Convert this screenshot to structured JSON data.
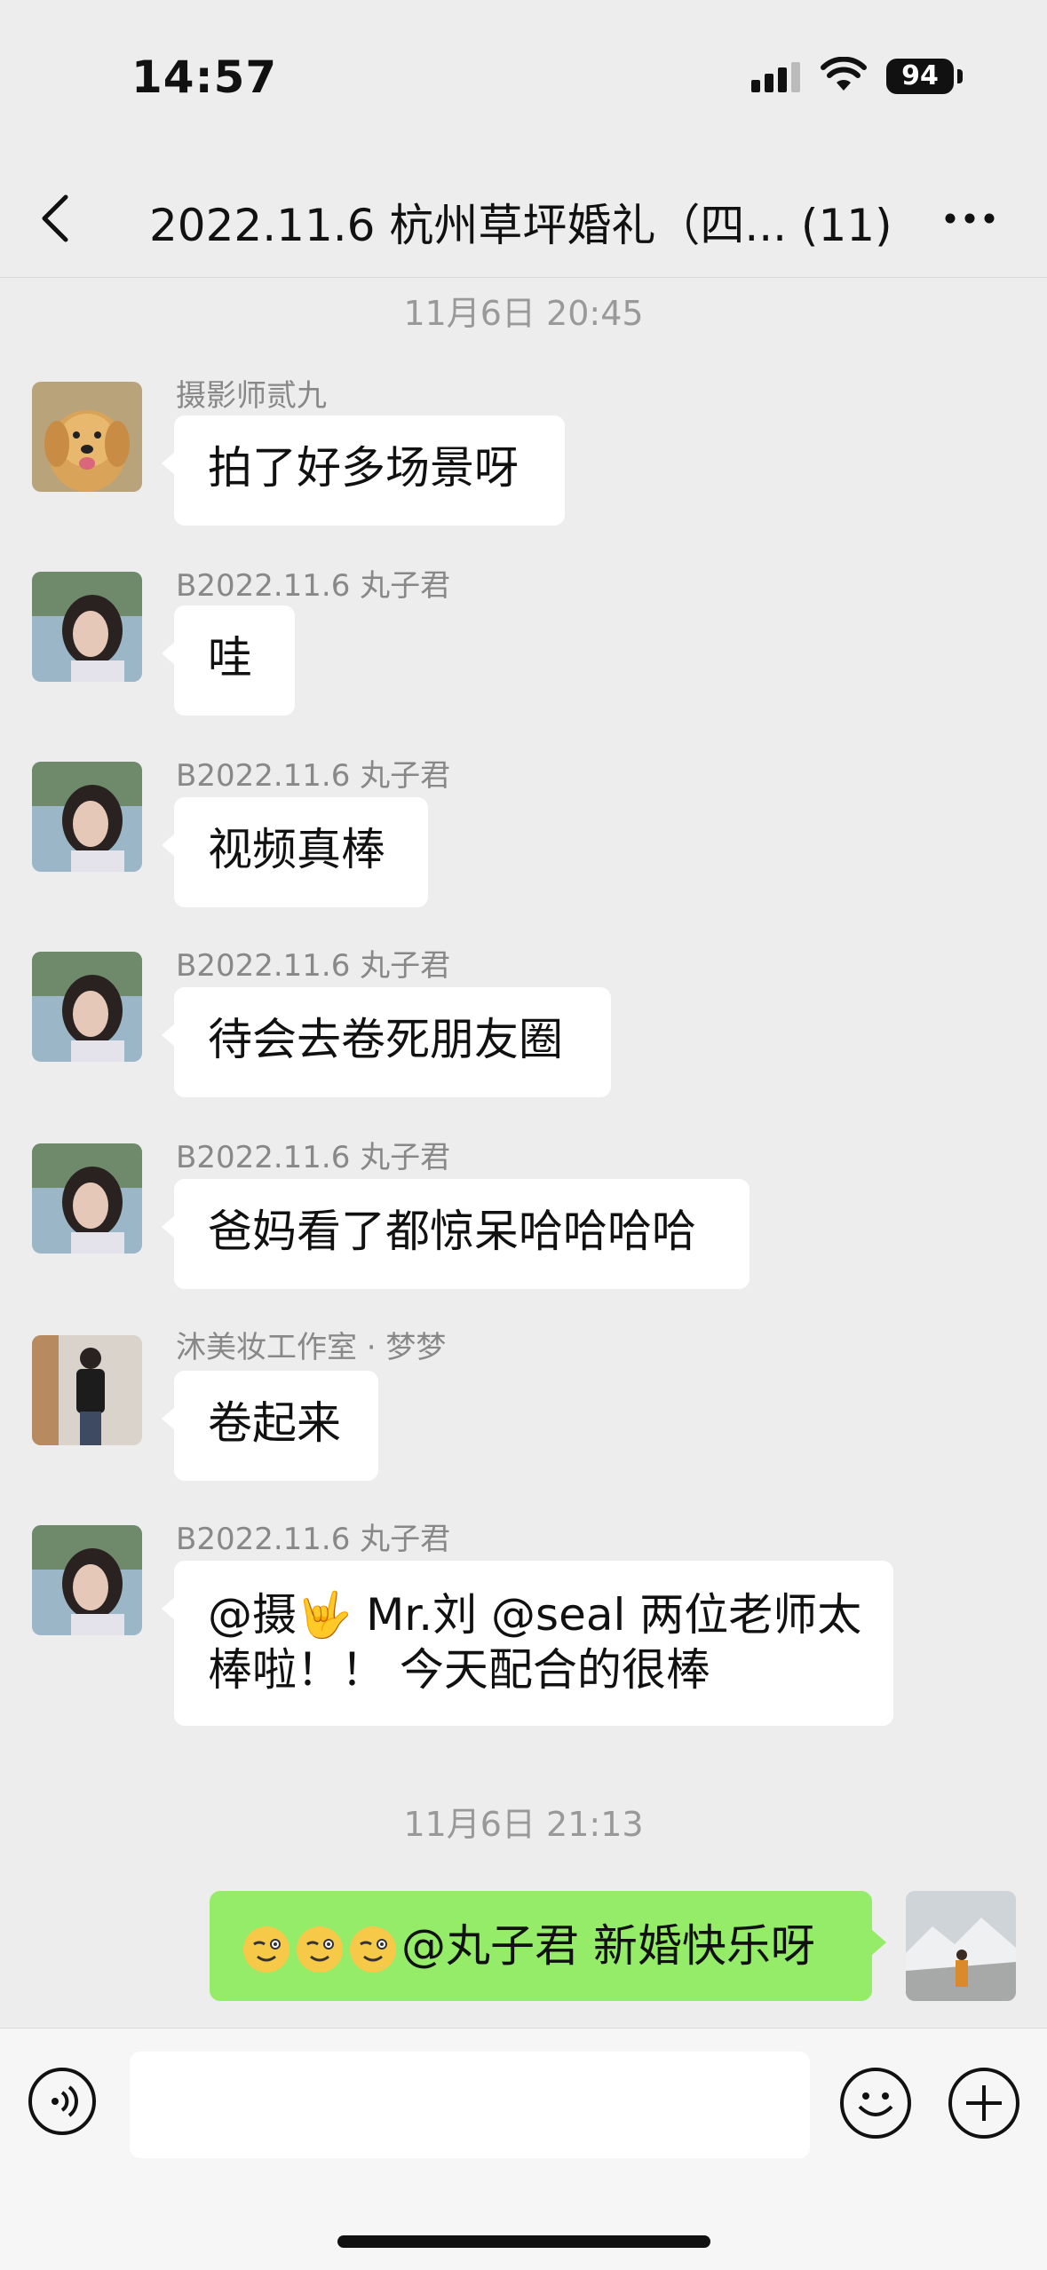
{
  "status": {
    "time": "14:57",
    "battery": "94"
  },
  "nav": {
    "title": "2022.11.6 杭州草坪婚礼（四... (11)"
  },
  "timestamps": [
    "11月6日 20:45",
    "11月6日 21:13"
  ],
  "messages": [
    {
      "sender": "摄影师贰九",
      "text": "拍了好多场景呀"
    },
    {
      "sender": "B2022.11.6 丸子君",
      "text": "哇"
    },
    {
      "sender": "B2022.11.6 丸子君",
      "text": "视频真棒"
    },
    {
      "sender": "B2022.11.6 丸子君",
      "text": "待会去卷死朋友圈"
    },
    {
      "sender": "B2022.11.6 丸子君",
      "text": "爸妈看了都惊呆哈哈哈哈"
    },
    {
      "sender": "沐美妆工作室 · 梦梦",
      "text": "卷起来"
    },
    {
      "sender": "B2022.11.6 丸子君",
      "line1": "@摄🤟 Mr.刘 @seal 两位老师太",
      "line2": "棒啦！！ 今天配合的很棒"
    }
  ],
  "my_message": {
    "text": "@丸子君 新婚快乐呀"
  },
  "colors": {
    "background": "#ededed",
    "my_bubble": "#95ec69",
    "other_bubble": "#ffffff"
  }
}
